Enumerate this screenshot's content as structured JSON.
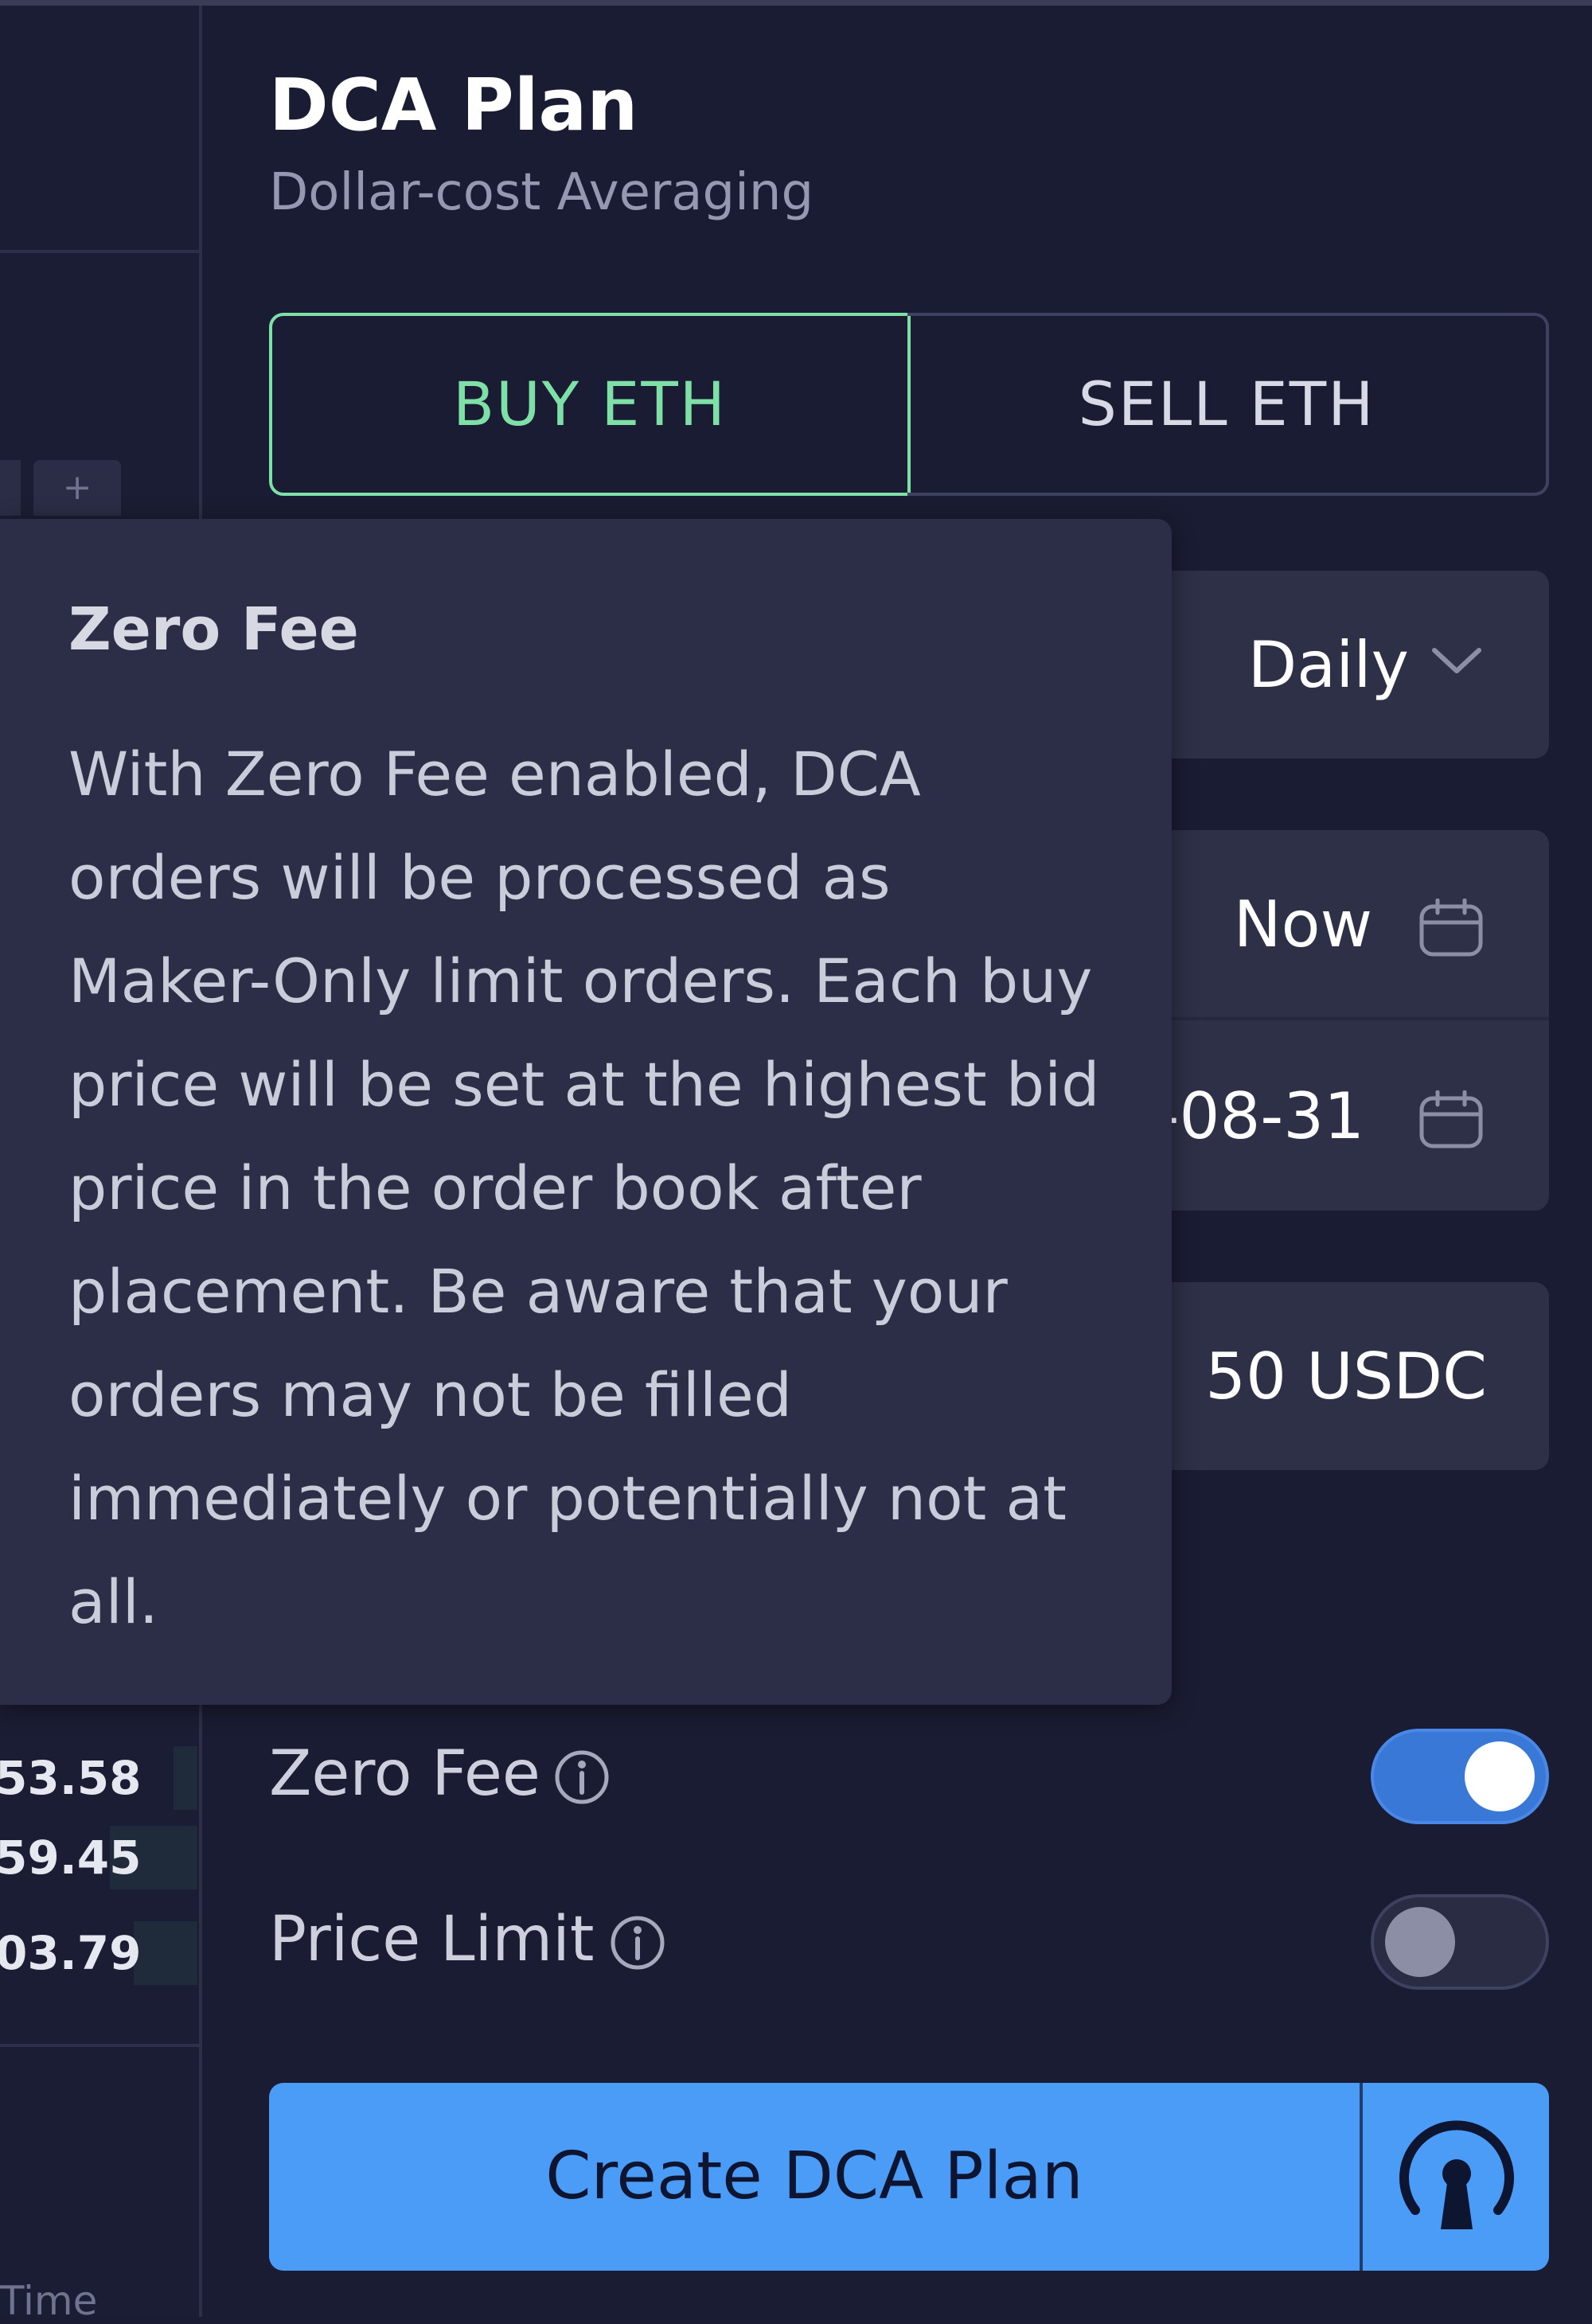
{
  "left_pane": {
    "plus_tab": "+",
    "order_book_prices": [
      "53.58",
      "59.45",
      "03.79"
    ],
    "time_label": "Time"
  },
  "dca": {
    "title": "DCA Plan",
    "subtitle": "Dollar-cost Averaging",
    "buy_label": "BUY ETH",
    "sell_label": "SELL ETH",
    "frequency_value": "Daily",
    "start_value": "Now",
    "end_value": "-08-31",
    "amount_value": "50",
    "amount_unit": "USDC",
    "zero_fee_label": "Zero Fee",
    "zero_fee_enabled": true,
    "price_limit_label": "Price Limit",
    "price_limit_enabled": false,
    "create_button": "Create DCA Plan"
  },
  "tooltip": {
    "title": "Zero Fee",
    "body": "With Zero Fee enabled, DCA orders will be processed as Maker-Only limit orders. Each buy price will be set at the highest bid price in the order book after placement. Be aware that your orders may not be filled immediately or potentially not at all."
  },
  "colors": {
    "accent_buy": "#7ee0a6",
    "primary_button": "#4b9cf7",
    "toggle_on": "#3a78d8",
    "panel_bg": "#1a1c33",
    "field_bg": "#2e3048",
    "tooltip_bg": "#2c2e47"
  },
  "icons": {
    "frequency_dropdown": "chevron-down-icon",
    "start_date": "calendar-icon",
    "end_date": "calendar-icon",
    "zero_fee_info": "info-icon",
    "price_limit_info": "info-icon",
    "wallet_lock": "lock-icon"
  }
}
